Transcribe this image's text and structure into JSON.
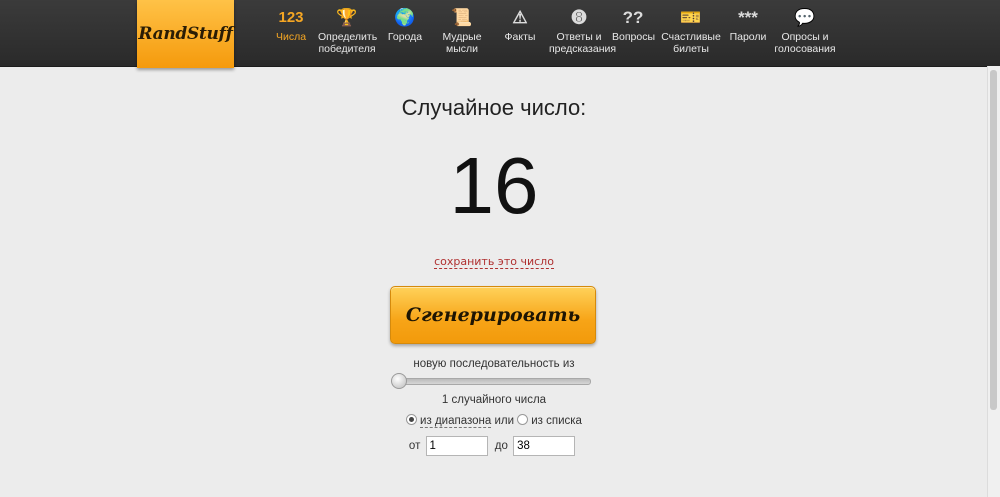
{
  "logo": {
    "text": "RandStuff"
  },
  "nav": [
    {
      "label": "Числа",
      "icon": "numbers-icon",
      "glyph": "123",
      "active": true
    },
    {
      "label": "Определить\nпобедителя",
      "icon": "trophy-icon",
      "glyph": "🏆"
    },
    {
      "label": "Города",
      "icon": "globe-icon",
      "glyph": "🌍"
    },
    {
      "label": "Мудрые\nмысли",
      "icon": "scroll-icon",
      "glyph": "📜"
    },
    {
      "label": "Факты",
      "icon": "warning-icon",
      "glyph": "⚠"
    },
    {
      "label": "Ответы и\nпредсказания",
      "icon": "eight-ball-icon",
      "glyph": "➑"
    },
    {
      "label": "Вопросы",
      "icon": "question-icon",
      "glyph": "??"
    },
    {
      "label": "Счастливые\nбилеты",
      "icon": "ticket-icon",
      "glyph": "🎫"
    },
    {
      "label": "Пароли",
      "icon": "password-icon",
      "glyph": "***"
    },
    {
      "label": "Опросы и\nголосования",
      "icon": "poll-icon",
      "glyph": "💬"
    }
  ],
  "main": {
    "heading": "Случайное число:",
    "number": "16",
    "save_link": "сохранить это число",
    "generate_button": "Сгенерировать",
    "sequence_caption": "новую последовательность из",
    "count_caption": "1 случайного числа",
    "slider_value": 1,
    "mode": {
      "range_label": "из диапазона",
      "or_text": "или",
      "list_label": "из списка",
      "selected": "range"
    },
    "range": {
      "from_label": "от",
      "from_value": "1",
      "to_label": "до",
      "to_value": "38"
    }
  }
}
